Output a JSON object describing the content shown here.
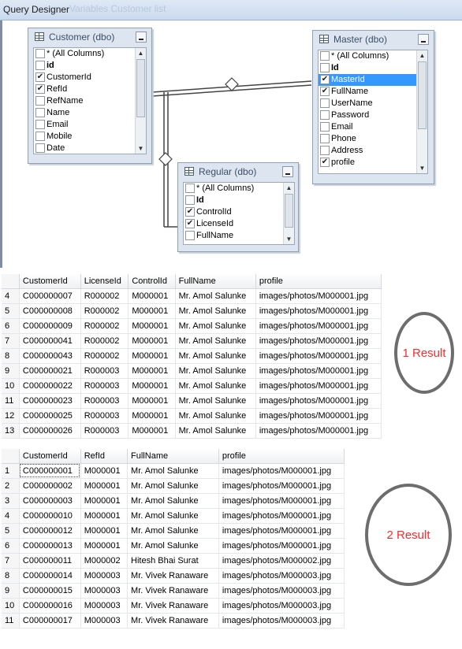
{
  "window": {
    "title": "Query Designer",
    "ghost_text": "Variables Customer list"
  },
  "designer": {
    "customer": {
      "title": "Customer (dbo)",
      "columns": [
        {
          "name": "* (All Columns)",
          "checked": false,
          "bold": false
        },
        {
          "name": "id",
          "checked": false,
          "bold": true
        },
        {
          "name": "CustomerId",
          "checked": true,
          "bold": false
        },
        {
          "name": "RefId",
          "checked": true,
          "bold": false
        },
        {
          "name": "RefName",
          "checked": false,
          "bold": false
        },
        {
          "name": "Name",
          "checked": false,
          "bold": false
        },
        {
          "name": "Email",
          "checked": false,
          "bold": false
        },
        {
          "name": "Mobile",
          "checked": false,
          "bold": false
        },
        {
          "name": "Date",
          "checked": false,
          "bold": false
        }
      ]
    },
    "master": {
      "title": "Master (dbo)",
      "columns": [
        {
          "name": "* (All Columns)",
          "checked": false,
          "bold": false
        },
        {
          "name": "Id",
          "checked": false,
          "bold": true
        },
        {
          "name": "MasterId",
          "checked": true,
          "bold": false,
          "selected": true
        },
        {
          "name": "FullName",
          "checked": true,
          "bold": false
        },
        {
          "name": "UserName",
          "checked": false,
          "bold": false
        },
        {
          "name": "Password",
          "checked": false,
          "bold": false
        },
        {
          "name": "Email",
          "checked": false,
          "bold": false
        },
        {
          "name": "Phone",
          "checked": false,
          "bold": false
        },
        {
          "name": "Address",
          "checked": false,
          "bold": false
        },
        {
          "name": "profile",
          "checked": true,
          "bold": false
        }
      ]
    },
    "regular": {
      "title": "Regular (dbo)",
      "columns": [
        {
          "name": "* (All Columns)",
          "checked": false,
          "bold": false
        },
        {
          "name": "Id",
          "checked": false,
          "bold": true
        },
        {
          "name": "ControlId",
          "checked": true,
          "bold": false
        },
        {
          "name": "LicenseId",
          "checked": true,
          "bold": false
        },
        {
          "name": "FullName",
          "checked": false,
          "bold": false
        }
      ]
    }
  },
  "result1": {
    "label": "1 Result",
    "headers": [
      "",
      "CustomerId",
      "LicenseId",
      "ControlId",
      "FullName",
      "profile"
    ],
    "rows": [
      [
        "4",
        "C000000007",
        "R000002",
        "M000001",
        "Mr. Amol Salunke",
        "images/photos/M000001.jpg"
      ],
      [
        "5",
        "C000000008",
        "R000002",
        "M000001",
        "Mr. Amol Salunke",
        "images/photos/M000001.jpg"
      ],
      [
        "6",
        "C000000009",
        "R000002",
        "M000001",
        "Mr. Amol Salunke",
        "images/photos/M000001.jpg"
      ],
      [
        "7",
        "C000000041",
        "R000002",
        "M000001",
        "Mr. Amol Salunke",
        "images/photos/M000001.jpg"
      ],
      [
        "8",
        "C000000043",
        "R000002",
        "M000001",
        "Mr. Amol Salunke",
        "images/photos/M000001.jpg"
      ],
      [
        "9",
        "C000000021",
        "R000003",
        "M000001",
        "Mr. Amol Salunke",
        "images/photos/M000001.jpg"
      ],
      [
        "10",
        "C000000022",
        "R000003",
        "M000001",
        "Mr. Amol Salunke",
        "images/photos/M000001.jpg"
      ],
      [
        "11",
        "C000000023",
        "R000003",
        "M000001",
        "Mr. Amol Salunke",
        "images/photos/M000001.jpg"
      ],
      [
        "12",
        "C000000025",
        "R000003",
        "M000001",
        "Mr. Amol Salunke",
        "images/photos/M000001.jpg"
      ],
      [
        "13",
        "C000000026",
        "R000003",
        "M000001",
        "Mr. Amol Salunke",
        "images/photos/M000001.jpg"
      ]
    ]
  },
  "result2": {
    "label": "2 Result",
    "headers": [
      "",
      "CustomerId",
      "RefId",
      "FullName",
      "profile"
    ],
    "rows": [
      [
        "1",
        "C000000001",
        "M000001",
        "Mr. Amol Salunke",
        "images/photos/M000001.jpg"
      ],
      [
        "2",
        "C000000002",
        "M000001",
        "Mr. Amol Salunke",
        "images/photos/M000001.jpg"
      ],
      [
        "3",
        "C000000003",
        "M000001",
        "Mr. Amol Salunke",
        "images/photos/M000001.jpg"
      ],
      [
        "4",
        "C000000010",
        "M000001",
        "Mr. Amol Salunke",
        "images/photos/M000001.jpg"
      ],
      [
        "5",
        "C000000012",
        "M000001",
        "Mr. Amol Salunke",
        "images/photos/M000001.jpg"
      ],
      [
        "6",
        "C000000013",
        "M000001",
        "Mr. Amol Salunke",
        "images/photos/M000001.jpg"
      ],
      [
        "7",
        "C000000011",
        "M000002",
        "Hitesh Bhai Surat",
        "images/photos/M000002.jpg"
      ],
      [
        "8",
        "C000000014",
        "M000003",
        "Mr. Vivek Ranaware",
        "images/photos/M000003.jpg"
      ],
      [
        "9",
        "C000000015",
        "M000003",
        "Mr. Vivek Ranaware",
        "images/photos/M000003.jpg"
      ],
      [
        "10",
        "C000000016",
        "M000003",
        "Mr. Vivek Ranaware",
        "images/photos/M000003.jpg"
      ],
      [
        "11",
        "C000000017",
        "M000003",
        "Mr. Vivek Ranaware",
        "images/photos/M000003.jpg"
      ]
    ]
  }
}
